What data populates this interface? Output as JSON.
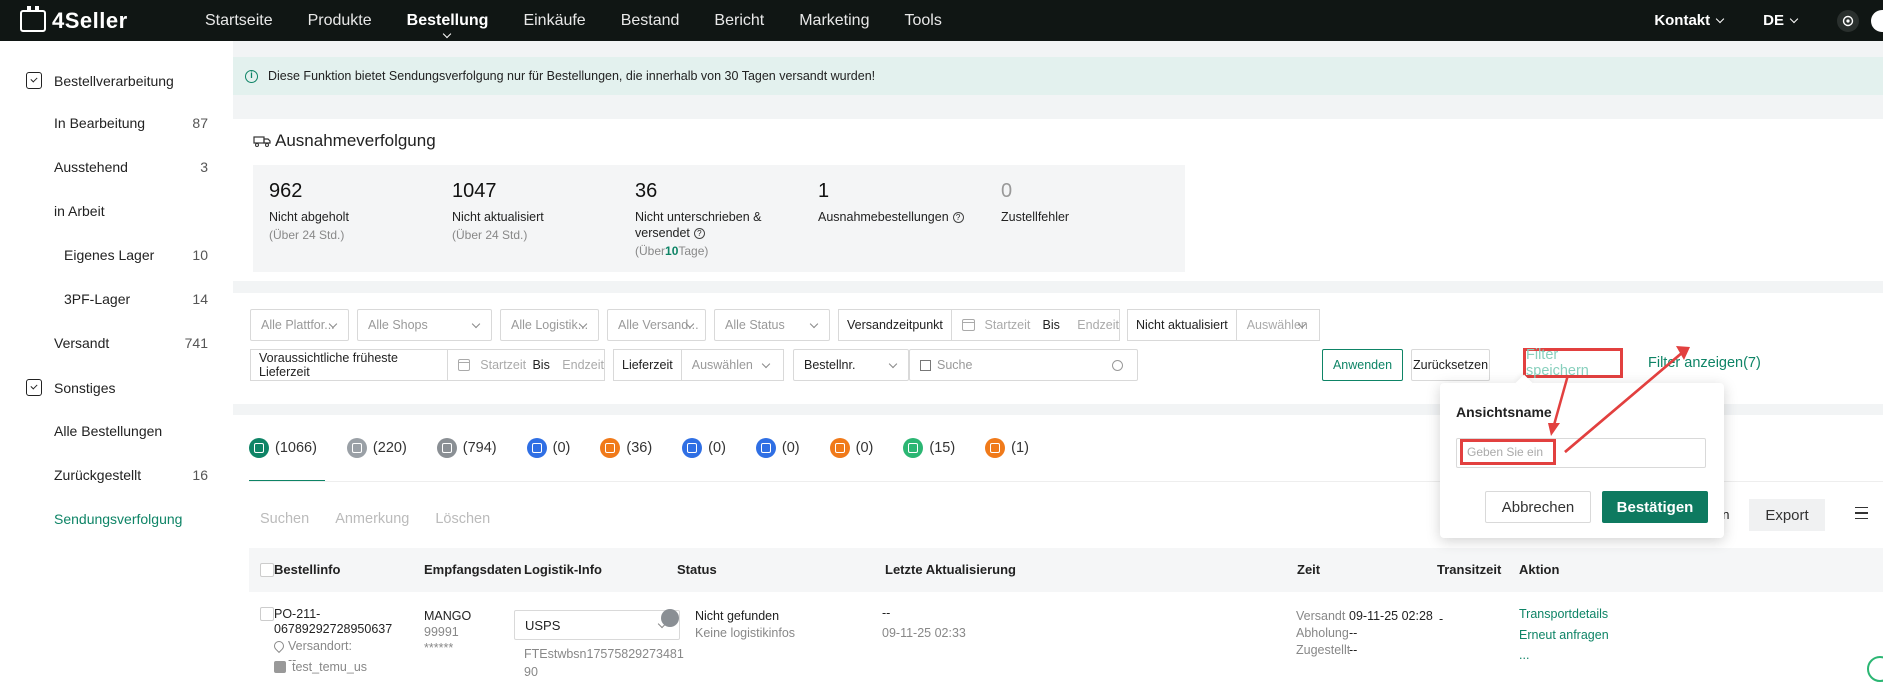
{
  "app": {
    "logo": "4Seller"
  },
  "nav": {
    "items": [
      "Startseite",
      "Produkte",
      "Bestellung",
      "Einkäufe",
      "Bestand",
      "Bericht",
      "Marketing",
      "Tools"
    ],
    "right": {
      "contact": "Kontakt",
      "lang": "DE"
    }
  },
  "sidebar": {
    "group1": "Bestellverarbeitung",
    "items1": [
      {
        "label": "In Bearbeitung",
        "count": "87"
      },
      {
        "label": "Ausstehend",
        "count": "3"
      },
      {
        "label": "in Arbeit",
        "count": ""
      },
      {
        "label": "Eigenes Lager",
        "count": "10"
      },
      {
        "label": "3PF-Lager",
        "count": "14"
      },
      {
        "label": "Versandt",
        "count": "741"
      }
    ],
    "group2": "Sonstiges",
    "items2": [
      {
        "label": "Alle Bestellungen",
        "count": ""
      },
      {
        "label": "Zurückgestellt",
        "count": "16"
      },
      {
        "label": "Sendungsverfolgung",
        "count": ""
      }
    ]
  },
  "notice": "Diese Funktion bietet Sendungsverfolgung nur für Bestellungen, die innerhalb von 30 Tagen versandt wurden!",
  "exception": {
    "title": "Ausnahmeverfolgung",
    "stats": [
      {
        "num": "962",
        "label": "Nicht abgeholt",
        "sub": "(Über 24 Std.)"
      },
      {
        "num": "1047",
        "label": "Nicht aktualisiert",
        "sub": "(Über 24 Std.)"
      },
      {
        "num": "36",
        "label": "Nicht unterschrieben &",
        "label2": "versendet",
        "sub_pre": "(Über",
        "sub_bold": "10",
        "sub_post": "Tage)"
      },
      {
        "num": "1",
        "label": "Ausnahmebestellungen"
      },
      {
        "num": "0",
        "label": "Zustellfehler"
      }
    ]
  },
  "filters": {
    "platform": "Alle Plattfor...",
    "shops": "Alle Shops",
    "logistics": "Alle Logistik...",
    "shipping": "Alle Versand...",
    "status": "Alle Status",
    "ship_time_label": "Versandzeitpunkt",
    "start_ph": "Startzeit",
    "end_ph": "Endzeit",
    "bis": "Bis",
    "not_updated_label": "Nicht aktualisiert",
    "choose": "Auswählen",
    "earliest_label": "Voraussichtliche früheste Lieferzeit",
    "delivery_label": "Lieferzeit",
    "order_no": "Bestellnr.",
    "search_ph": "Suche",
    "apply": "Anwenden",
    "reset": "Zurücksetzen",
    "save": "Filter speichern",
    "show": "Filter anzeigen(7)"
  },
  "tabs": [
    {
      "count": "(1066)",
      "color": "#0e8466"
    },
    {
      "count": "(220)",
      "color": "#9aa0a6"
    },
    {
      "count": "(794)",
      "color": "#8a8f94"
    },
    {
      "count": "(0)",
      "color": "#2f6fe4"
    },
    {
      "count": "(36)",
      "color": "#f07a1a"
    },
    {
      "count": "(0)",
      "color": "#2f6fe4"
    },
    {
      "count": "(0)",
      "color": "#2f6fe4"
    },
    {
      "count": "(0)",
      "color": "#f07a1a"
    },
    {
      "count": "(15)",
      "color": "#2bb673"
    },
    {
      "count": "(1)",
      "color": "#f07a1a"
    }
  ],
  "actions": {
    "search": "Suchen",
    "note": "Anmerkung",
    "delete": "Löschen",
    "export": "Export",
    "fragment": "en"
  },
  "table": {
    "headers": [
      "Bestellinfo",
      "Empfangsdaten",
      "Logistik-Info",
      "Status",
      "Letzte Aktualisierung",
      "Zeit",
      "Transitzeit",
      "Aktion"
    ],
    "row": {
      "order1": "PO-211-",
      "order2": "06789292728950637",
      "origin": "Versandort: --",
      "shop": "test_temu_us",
      "recipient": "MANGO",
      "zip": "99991",
      "masked": "******",
      "carrier": "USPS",
      "tracking1": "FTEstwbsn17575829273481",
      "tracking2": "90",
      "status": "Nicht gefunden",
      "status_sub": "Keine logistikinfos",
      "last_update": "--",
      "last_update_time": "09-11-25 02:33",
      "shipped_label": "Versandt",
      "shipped_time": "09-11-25 02:28",
      "pickup_label": "Abholung",
      "pickup_val": "--",
      "delivered_label": "Zugestellt",
      "delivered_val": "--",
      "transit": "-",
      "action1": "Transportdetails",
      "action2": "Erneut anfragen",
      "action3": "..."
    }
  },
  "popup": {
    "title": "Ansichtsname",
    "placeholder": "Geben Sie ein",
    "cancel": "Abbrechen",
    "confirm": "Bestätigen"
  }
}
